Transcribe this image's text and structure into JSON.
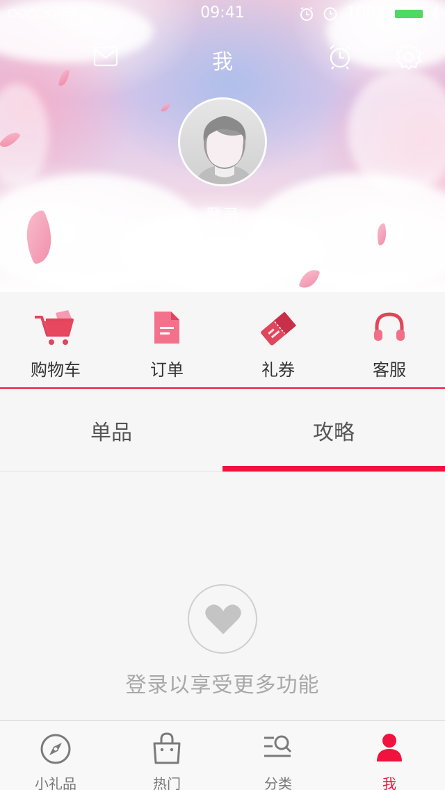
{
  "status_bar": {
    "time": "09:41",
    "battery_percent": "100%",
    "battery_level": 1.0
  },
  "header": {
    "title": "我",
    "icons": [
      "mail-icon",
      "alarm-icon",
      "settings-icon"
    ]
  },
  "profile": {
    "login_label": "登录"
  },
  "quick_menu": {
    "items": [
      {
        "label": "购物车",
        "icon": "shopping-cart-icon"
      },
      {
        "label": "订单",
        "icon": "order-document-icon"
      },
      {
        "label": "礼券",
        "icon": "coupon-ticket-icon"
      },
      {
        "label": "客服",
        "icon": "headphones-icon"
      }
    ]
  },
  "tabs": {
    "items": [
      {
        "label": "单品",
        "active": false
      },
      {
        "label": "攻略",
        "active": true
      }
    ]
  },
  "empty_state": {
    "icon": "heart-icon",
    "message": "登录以享受更多功能"
  },
  "tab_bar": {
    "items": [
      {
        "label": "小礼品",
        "icon": "compass-icon",
        "active": false
      },
      {
        "label": "热门",
        "icon": "shopping-bag-icon",
        "active": false
      },
      {
        "label": "分类",
        "icon": "category-search-icon",
        "active": false
      },
      {
        "label": "我",
        "icon": "person-icon",
        "active": true
      }
    ]
  },
  "colors": {
    "accent": "#f0133d",
    "icon_pink": "#ef5d7a",
    "battery_green": "#4cd964"
  }
}
